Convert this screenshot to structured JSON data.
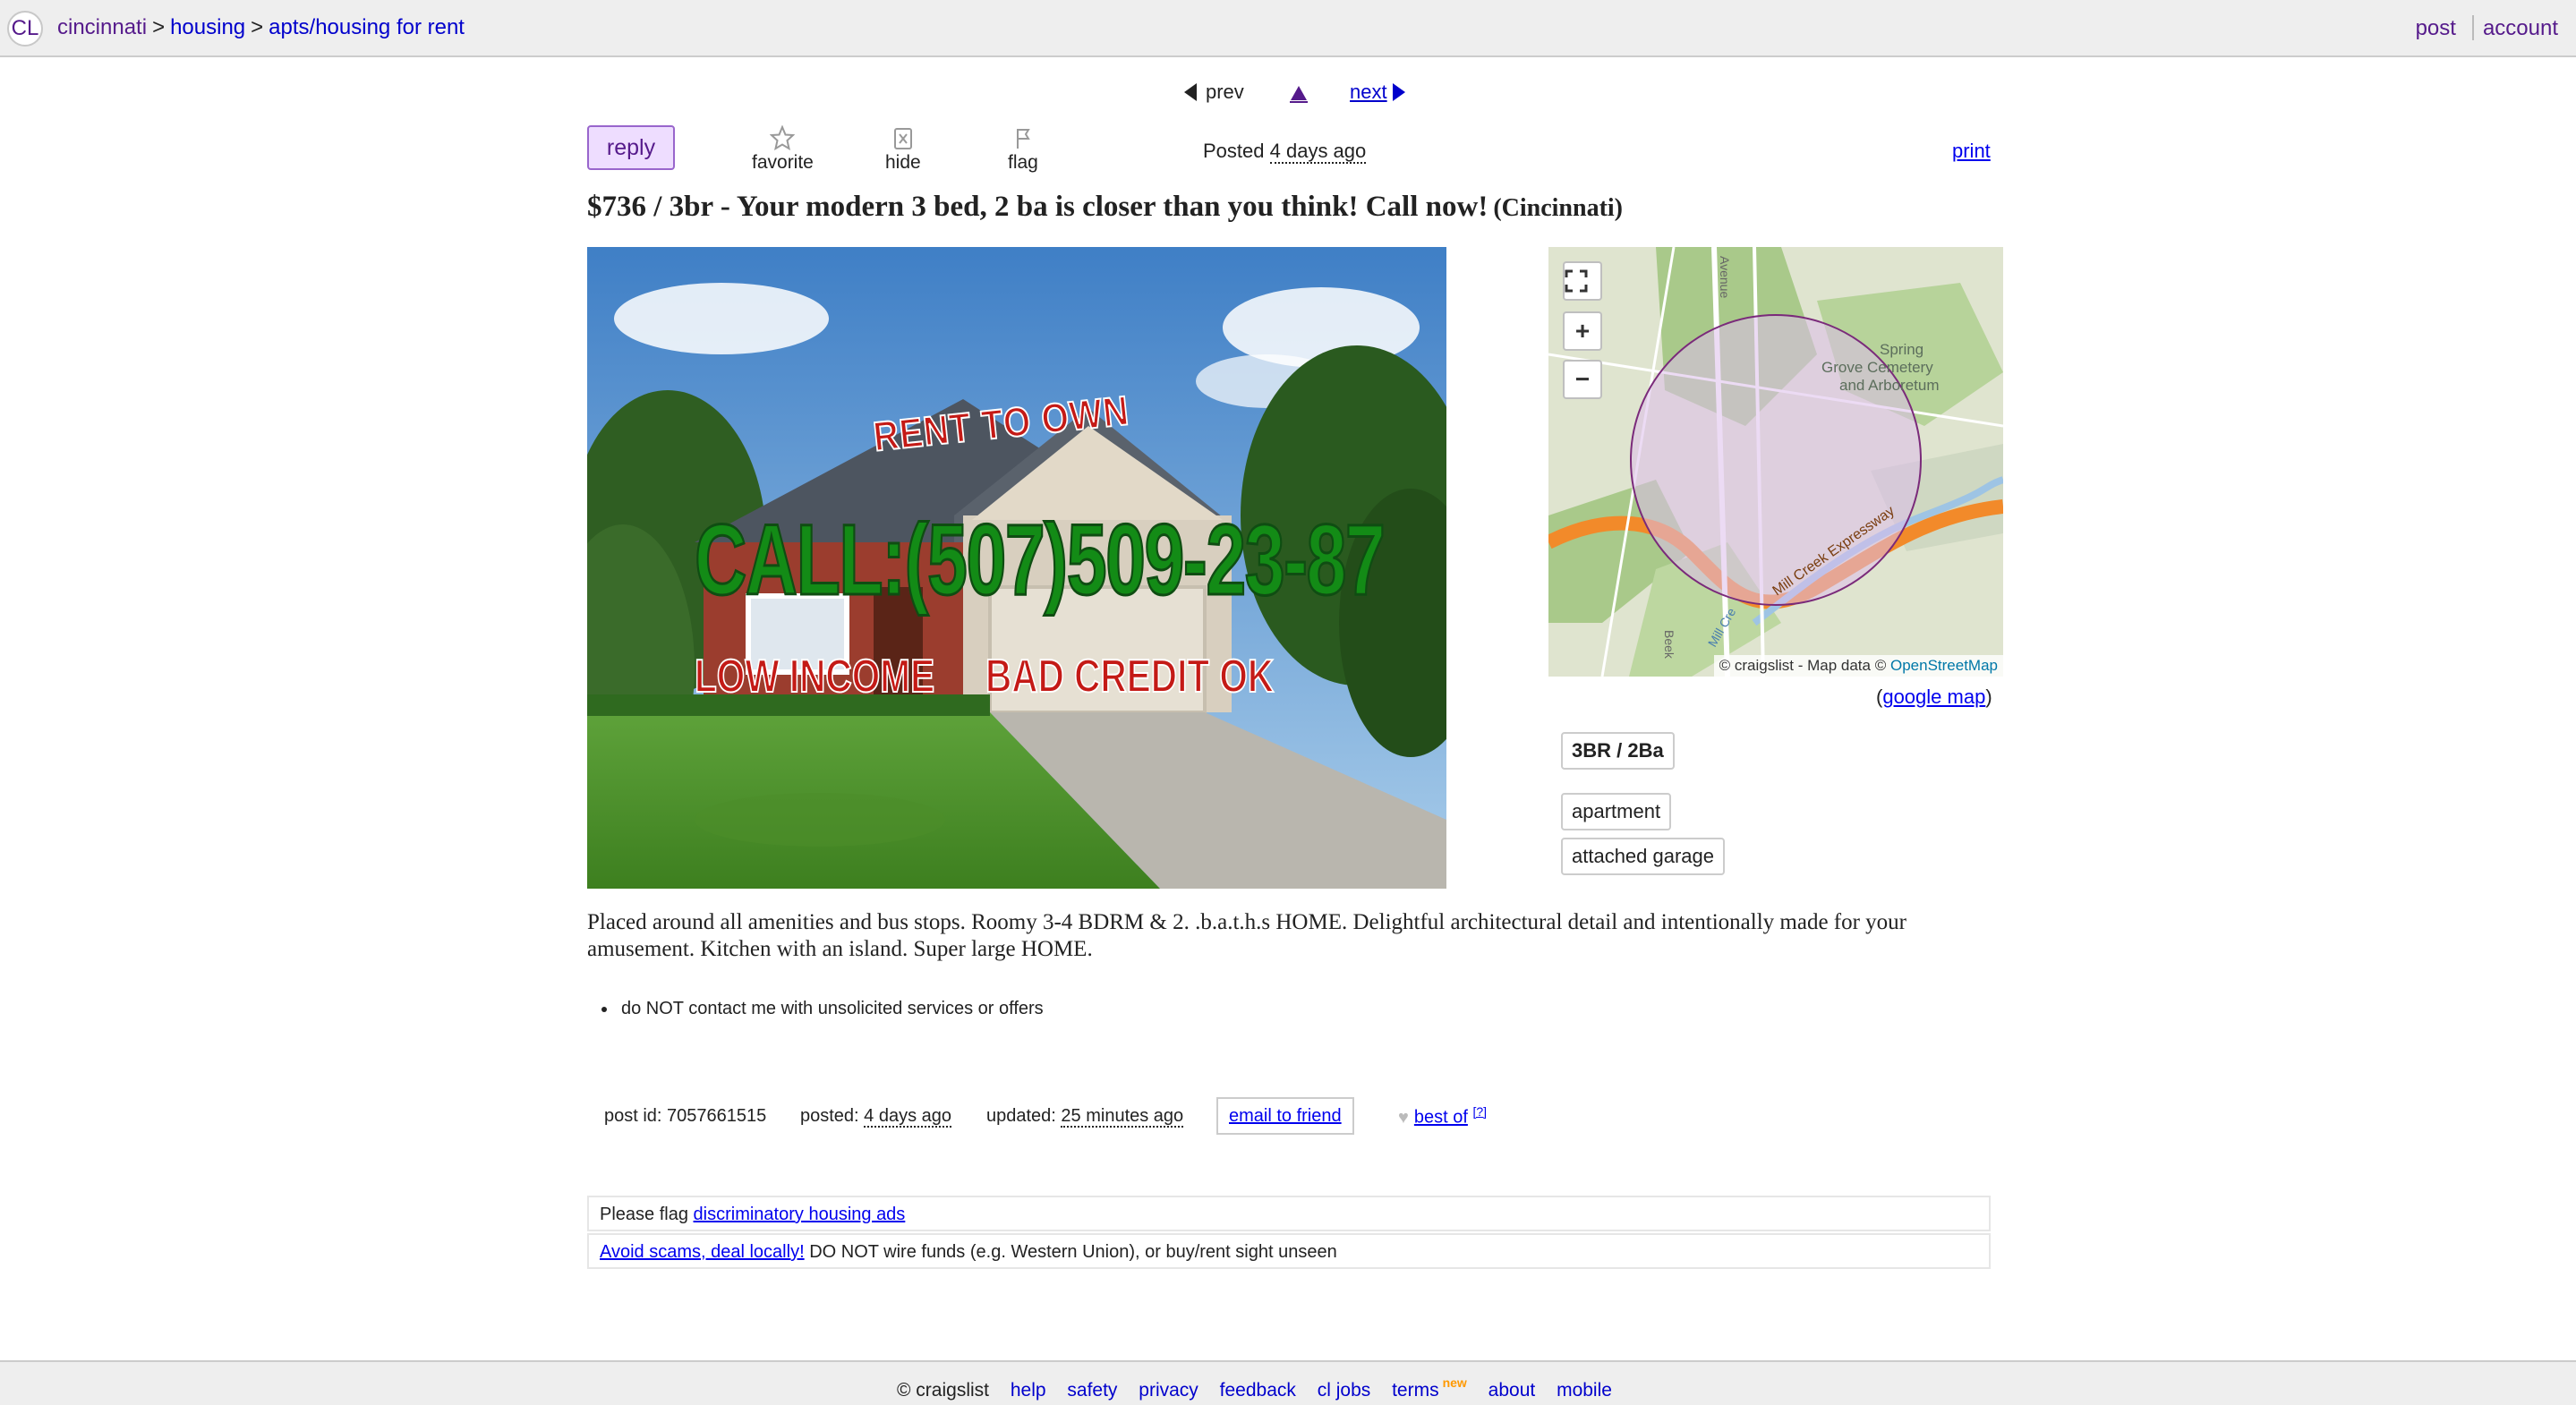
{
  "header": {
    "logo": "CL",
    "breadcrumb": {
      "site": "cincinnati",
      "section": "housing",
      "category": "apts/housing for rent",
      "separator": ">"
    },
    "post_link": "post",
    "account_link": "account"
  },
  "nav": {
    "prev": "prev",
    "next": "next"
  },
  "actions": {
    "reply": "reply",
    "favorite": "favorite",
    "hide": "hide",
    "flag": "flag",
    "posted_label": "Posted",
    "posted_value": "4 days ago",
    "print": "print"
  },
  "listing": {
    "title": "$736 / 3br - Your modern 3 bed, 2 ba is closer than you think! Call now!",
    "neighborhood": "(Cincinnati)",
    "photo_text": {
      "rent_to_own": "RENT TO OWN",
      "call": "CALL:(507)509-23-87",
      "low_income": "LOW INCOME",
      "bad_credit": "BAD CREDIT OK"
    },
    "body": "Placed around all amenities and bus stops. Roomy 3-4 BDRM & 2. .b.a.t.h.s HOME. Delightful architectural detail and intentionally made for your amusement. Kitchen with an island. Super large HOME.",
    "notices": [
      "do NOT contact me with unsolicited services or offers"
    ]
  },
  "map": {
    "labels": {
      "cemetery_1": "Spring",
      "cemetery_2": "Grove Cemetery",
      "cemetery_3": "and Arboretum",
      "expressway": "Mill Creek Expressway",
      "road_1": "Avenue",
      "road_2": "Mill Cre",
      "road_3": "Beek"
    },
    "attribution_prefix": "© craigslist - Map data ©",
    "attribution_link": "OpenStreetMap",
    "google_map": "google map",
    "zoom_in": "+",
    "zoom_out": "−"
  },
  "attributes": {
    "br_ba": "3BR / 2Ba",
    "type": "apartment",
    "parking": "attached garage"
  },
  "post_info": {
    "post_id_label": "post id: 7057661515",
    "posted_label": "posted:",
    "posted_value": "4 days ago",
    "updated_label": "updated:",
    "updated_value": "25 minutes ago",
    "email_friend": "email to friend",
    "best_of": "best of",
    "best_of_help": "[?]"
  },
  "warnings": {
    "flag_prefix": "Please flag",
    "flag_link": "discriminatory housing ads",
    "scam_link": "Avoid scams, deal locally!",
    "scam_text": "DO NOT wire funds (e.g. Western Union), or buy/rent sight unseen"
  },
  "footer": {
    "copyright": "© craigslist",
    "links": [
      "help",
      "safety",
      "privacy",
      "feedback",
      "cl jobs",
      "terms",
      "about",
      "mobile"
    ],
    "new_badge": "new"
  }
}
